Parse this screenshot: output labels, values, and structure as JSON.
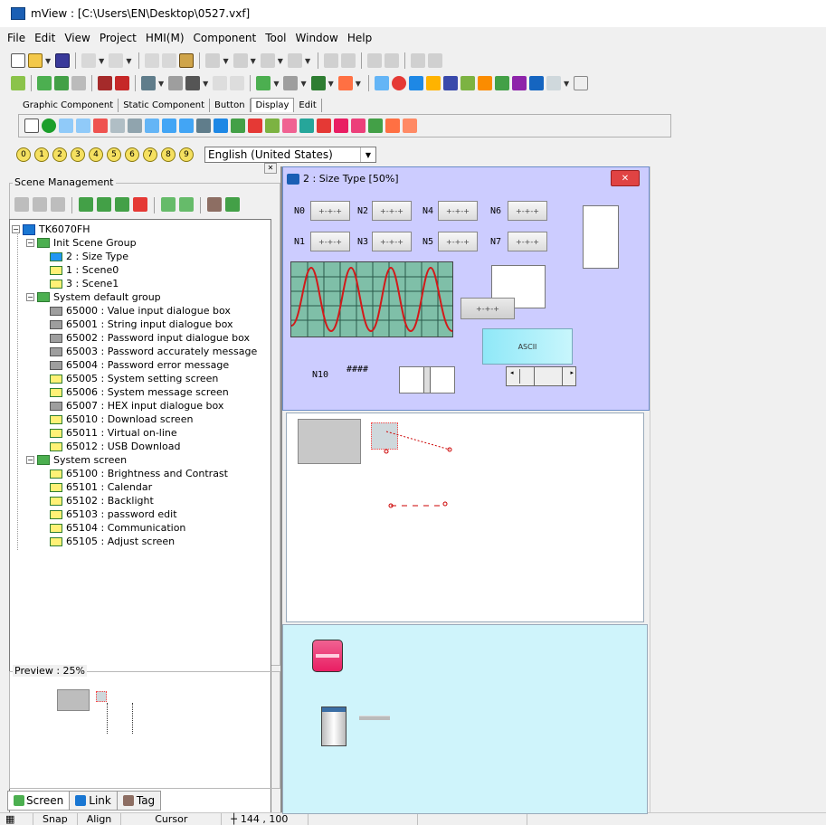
{
  "window": {
    "title": "mView : [C:\\Users\\EN\\Desktop\\0527.vxf]"
  },
  "menu": [
    "File",
    "Edit",
    "View",
    "Project",
    "HMI(M)",
    "Component",
    "Tool",
    "Window",
    "Help"
  ],
  "component_tabs": [
    {
      "label": "Graphic Component",
      "active": false
    },
    {
      "label": "Static Component",
      "active": false
    },
    {
      "label": "Button",
      "active": false
    },
    {
      "label": "Display",
      "active": true
    },
    {
      "label": "Edit",
      "active": false
    }
  ],
  "number_buttons": [
    "0",
    "1",
    "2",
    "3",
    "4",
    "5",
    "6",
    "7",
    "8",
    "9"
  ],
  "language": {
    "selected": "English (United States)"
  },
  "scene_management": {
    "title": "Scene Management",
    "tree": [
      {
        "label": "TK6070FH",
        "level": 0,
        "icon": "device-icon",
        "expander": "-"
      },
      {
        "label": "Init Scene Group",
        "level": 1,
        "icon": "scene-group-icon",
        "expander": "-"
      },
      {
        "label": "2 : Size Type",
        "level": 2,
        "icon": "active-scene-icon"
      },
      {
        "label": "1 : Scene0",
        "level": 2,
        "icon": "scene-icon"
      },
      {
        "label": "3 : Scene1",
        "level": 2,
        "icon": "scene-icon"
      },
      {
        "label": "System default group",
        "level": 1,
        "icon": "scene-group-icon",
        "expander": "-"
      },
      {
        "label": "65000 : Value input dialogue box",
        "level": 2,
        "icon": "dialog-icon"
      },
      {
        "label": "65001 : String input dialogue box",
        "level": 2,
        "icon": "dialog-icon"
      },
      {
        "label": "65002 : Password input dialogue box",
        "level": 2,
        "icon": "dialog-icon"
      },
      {
        "label": "65003 : Password accurately message",
        "level": 2,
        "icon": "dialog-icon"
      },
      {
        "label": "65004 : Password error message",
        "level": 2,
        "icon": "dialog-icon"
      },
      {
        "label": "65005 : System setting screen",
        "level": 2,
        "icon": "scene-icon"
      },
      {
        "label": "65006 : System message screen",
        "level": 2,
        "icon": "scene-icon"
      },
      {
        "label": "65007 : HEX input dialogue box",
        "level": 2,
        "icon": "dialog-icon"
      },
      {
        "label": "65010 : Download screen",
        "level": 2,
        "icon": "scene-icon"
      },
      {
        "label": "65011 : Virtual on-line",
        "level": 2,
        "icon": "scene-icon"
      },
      {
        "label": "65012 : USB Download",
        "level": 2,
        "icon": "scene-icon"
      },
      {
        "label": "System screen",
        "level": 1,
        "icon": "scene-group-icon",
        "expander": "-"
      },
      {
        "label": "65100 : Brightness and Contrast",
        "level": 2,
        "icon": "scene-icon"
      },
      {
        "label": "65101 : Calendar",
        "level": 2,
        "icon": "scene-icon"
      },
      {
        "label": "65102 : Backlight",
        "level": 2,
        "icon": "scene-icon"
      },
      {
        "label": "65103 : password edit",
        "level": 2,
        "icon": "scene-icon"
      },
      {
        "label": "65104 : Communication",
        "level": 2,
        "icon": "scene-icon"
      },
      {
        "label": "65105 : Adjust screen",
        "level": 2,
        "icon": "scene-icon"
      }
    ]
  },
  "preview": {
    "title": "Preview : 25%"
  },
  "bottom_tabs": [
    {
      "label": "Screen",
      "icon": "screen-tab-icon",
      "active": true
    },
    {
      "label": "Link",
      "icon": "link-tab-icon",
      "active": false
    },
    {
      "label": "Tag",
      "icon": "tag-tab-icon",
      "active": false
    }
  ],
  "status": {
    "snap": "Snap",
    "align": "Align",
    "cursor": "Cursor",
    "coords": "144 , 100"
  },
  "child_window": {
    "title": "2 : Size Type [50%]",
    "labels": [
      "N0",
      "N1",
      "N2",
      "N3",
      "N4",
      "N5",
      "N6",
      "N7",
      "N10"
    ],
    "hash": "####",
    "num_placeholder": "+-+-+",
    "ascii_text": "ASCII"
  },
  "colors": {
    "canvas_bg": "#ccccff",
    "lower_canvas": "#cff4fb",
    "close_red": "#e04343"
  }
}
